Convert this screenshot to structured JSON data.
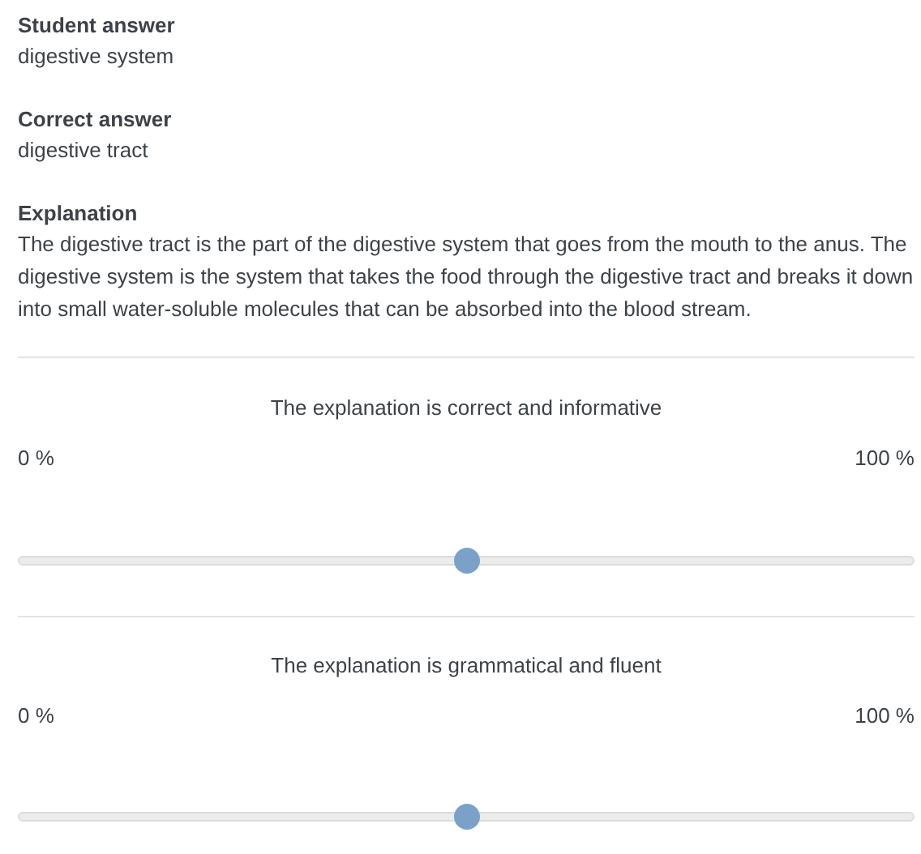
{
  "fields": [
    {
      "label": "Student answer",
      "value": "digestive system"
    },
    {
      "label": "Correct answer",
      "value": "digestive tract"
    },
    {
      "label": "Explanation",
      "value": "The digestive tract is the part of the digestive system that goes from the mouth to the anus. The digestive system is the system that takes the food through the digestive tract and breaks it down into small water-soluble molecules that can be absorbed into the blood stream."
    }
  ],
  "ratings": [
    {
      "question": "The explanation is correct and informative",
      "min_label": "0 %",
      "max_label": "100 %",
      "level": 0.5
    },
    {
      "question": "The explanation is grammatical and fluent",
      "min_label": "0 %",
      "max_label": "100 %",
      "level": 0.5
    }
  ]
}
